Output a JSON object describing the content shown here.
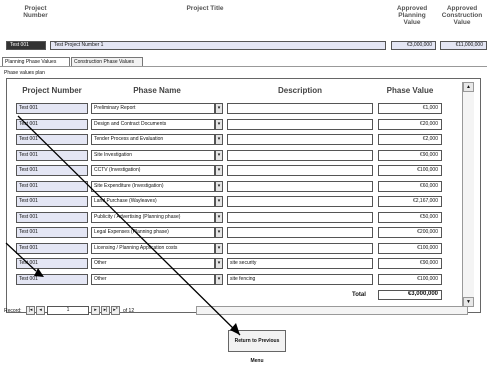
{
  "header": {
    "project_number_label": "Project Number",
    "project_title_label": "Project Title",
    "approved_planning_label": "Approved Planning Value",
    "approved_construction_label": "Approved Construction Value",
    "project_number_value": "Test 001",
    "project_title_value": "Test Project Number 1",
    "approved_planning_value": "€3,000,000",
    "approved_construction_value": "€11,000,000"
  },
  "tabs": [
    {
      "label": "Planning Phase Values",
      "active": true
    },
    {
      "label": "Construction Phase Values",
      "active": false
    }
  ],
  "subform": {
    "caption": "Phase values plan",
    "columns": [
      "Project Number",
      "Phase Name",
      "Description",
      "Phase Value"
    ],
    "rows": [
      {
        "project": "Test 001",
        "phase": "Preliminary Report",
        "description": "",
        "value": "€1,000"
      },
      {
        "project": "Test 001",
        "phase": "Design and Contract Documents",
        "description": "",
        "value": "€20,000"
      },
      {
        "project": "Test 001",
        "phase": "Tender Process and Evaluation",
        "description": "",
        "value": "€2,000"
      },
      {
        "project": "Test 001",
        "phase": "Site Investigation",
        "description": "",
        "value": "€90,000"
      },
      {
        "project": "Test 001",
        "phase": "CCTV (Investigation)",
        "description": "",
        "value": "€100,000"
      },
      {
        "project": "Test 001",
        "phase": "Site Expenditure (Investigation)",
        "description": "",
        "value": "€60,000"
      },
      {
        "project": "Test 001",
        "phase": "Land Purchase (Wayleaves)",
        "description": "",
        "value": "€2,167,000"
      },
      {
        "project": "Test 001",
        "phase": "Publicity / Advertising (Planning phase)",
        "description": "",
        "value": "€50,000"
      },
      {
        "project": "Test 001",
        "phase": "Legal Expenses (Planning phase)",
        "description": "",
        "value": "€200,000"
      },
      {
        "project": "Test 001",
        "phase": "Licensing / Planning Application costs",
        "description": "",
        "value": "€100,000"
      },
      {
        "project": "Test 001",
        "phase": "Other",
        "description": "site security",
        "value": "€90,000"
      },
      {
        "project": "Test 001",
        "phase": "Other",
        "description": "site fencing",
        "value": "€100,000"
      }
    ],
    "total_label": "Total",
    "total_value": "€3,000,000"
  },
  "record_nav": {
    "label": "Record:",
    "current": "1",
    "of_text": "of 12"
  },
  "footer": {
    "return_button": "Return to Previous Menu"
  },
  "colors": {
    "field_fill": "#e4e6f4",
    "border": "#555555"
  }
}
